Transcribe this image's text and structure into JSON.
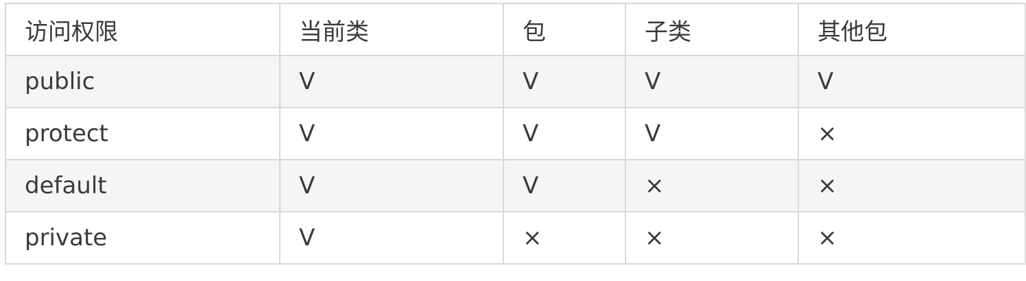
{
  "table": {
    "headers": [
      "访问权限",
      "当前类",
      "包",
      "子类",
      "其他包"
    ],
    "rows": [
      [
        "public",
        "V",
        "V",
        "V",
        "V"
      ],
      [
        "protect",
        "V",
        "V",
        "V",
        "×"
      ],
      [
        "default",
        "V",
        "V",
        "×",
        "×"
      ],
      [
        "private",
        "V",
        "×",
        "×",
        "×"
      ]
    ]
  },
  "colors": {
    "border": "#d9d9d9",
    "stripe_background": "#f5f5f5",
    "text": "#3a3a3a"
  }
}
